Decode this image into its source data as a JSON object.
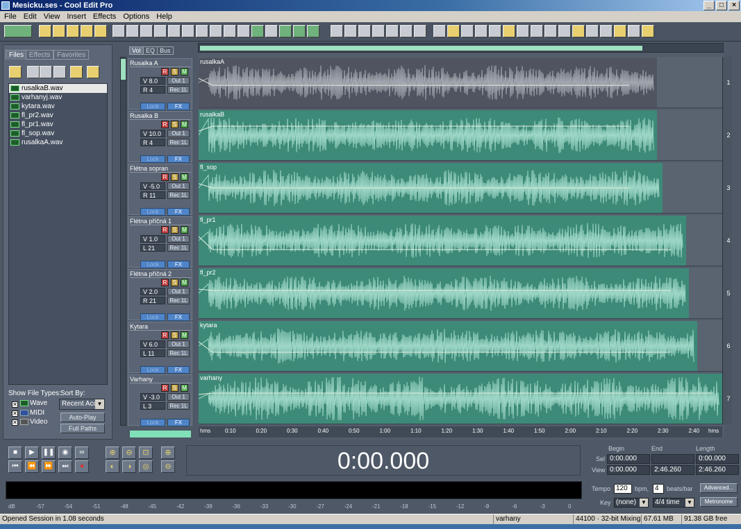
{
  "window": {
    "title": "Mesicku.ses - Cool Edit Pro"
  },
  "menu": [
    "File",
    "Edit",
    "View",
    "Insert",
    "Effects",
    "Options",
    "Help"
  ],
  "left_panel": {
    "tabs": [
      "Files",
      "Effects",
      "Favorites"
    ],
    "files": [
      "rusalkaB.wav",
      "varhanyj.wav",
      "kytara.wav",
      "fl_pr2.wav",
      "fl_pr1.wav",
      "fl_sop.wav",
      "rusalkaA.wav"
    ],
    "selected_file": "rusalkaB.wav",
    "show_file_types_label": "Show File Types:",
    "sort_by_label": "Sort By:",
    "file_types": [
      "Wave",
      "MIDI",
      "Video"
    ],
    "sort_value": "Recent Acc",
    "auto_play": "Auto-Play",
    "full_paths": "Full Paths"
  },
  "track_tabs": [
    "Vol",
    "EQ",
    "Bus"
  ],
  "tracks": [
    {
      "name": "Rusalka A",
      "v": "V 8.0",
      "pan": "R 4",
      "out": "Out 1",
      "rec": "Rec 1L",
      "lock": "Lock",
      "fx": "FX",
      "clip": "rusalkaA",
      "num": "1"
    },
    {
      "name": "Rusalka B",
      "v": "V 10.0",
      "pan": "R 4",
      "out": "Out 1",
      "rec": "Rec 1L",
      "lock": "Lock",
      "fx": "FX",
      "clip": "rusalkaB",
      "num": "2"
    },
    {
      "name": "Flétna sopran",
      "v": "V -5.0",
      "pan": "R 11",
      "out": "Out 1",
      "rec": "Rec 1L",
      "lock": "Lock",
      "fx": "FX",
      "clip": "fl_sop",
      "num": "3"
    },
    {
      "name": "Flétna příčná 1",
      "v": "V 1.0",
      "pan": "L 21",
      "out": "Out 1",
      "rec": "Rec 1L",
      "lock": "Lock",
      "fx": "FX",
      "clip": "fl_pr1",
      "num": "4"
    },
    {
      "name": "Flétna příčná 2",
      "v": "V 2.0",
      "pan": "R 21",
      "out": "Out 1",
      "rec": "Rec 1L",
      "lock": "Lock",
      "fx": "FX",
      "clip": "fl_pr2",
      "num": "5"
    },
    {
      "name": "Kytara",
      "v": "V 6.0",
      "pan": "L 11",
      "out": "Out 1",
      "rec": "Rec 1L",
      "lock": "Lock",
      "fx": "FX",
      "clip": "kytara",
      "num": "6"
    },
    {
      "name": "Varhany",
      "v": "V -3.0",
      "pan": "L 3",
      "out": "Out 1",
      "rec": "Rec 1L",
      "lock": "Lock",
      "fx": "FX",
      "clip": "varhany",
      "num": "7"
    }
  ],
  "rsm": [
    "R",
    "S",
    "M"
  ],
  "ruler": [
    "hms",
    "0:10",
    "0:20",
    "0:30",
    "0:40",
    "0:50",
    "1:00",
    "1:10",
    "1:20",
    "1:30",
    "1:40",
    "1:50",
    "2:00",
    "2:10",
    "2:20",
    "2:30",
    "2:40",
    "hms"
  ],
  "time_display": "0:00.000",
  "selview": {
    "headers": [
      "Begin",
      "End",
      "Length"
    ],
    "sel_label": "Sel",
    "view_label": "View",
    "sel": [
      "0:00.000",
      "",
      "0:00.000"
    ],
    "view": [
      "0:00.000",
      "2:46.260",
      "2:46.260"
    ]
  },
  "meter_ticks": [
    "dB",
    "-57",
    "-54",
    "-51",
    "-48",
    "-45",
    "-42",
    "-39",
    "-36",
    "-33",
    "-30",
    "-27",
    "-24",
    "-21",
    "-18",
    "-15",
    "-12",
    "-9",
    "-6",
    "-3",
    "0"
  ],
  "tempo": {
    "tempo_label": "Tempo",
    "tempo_value": "120",
    "bpm_label": "bpm,",
    "beats_value": "4",
    "beats_label": "beats/bar",
    "advanced": "Advanced...",
    "key_label": "Key",
    "key_value": "(none)",
    "time_sig": "4/4 time",
    "metronome": "Metronome"
  },
  "status": {
    "message": "Opened Session in 1.08 seconds",
    "track": "varhany",
    "format": "44100 · 32-bit Mixing",
    "mem": "67.61 MB",
    "free": "91.38 GB free"
  }
}
